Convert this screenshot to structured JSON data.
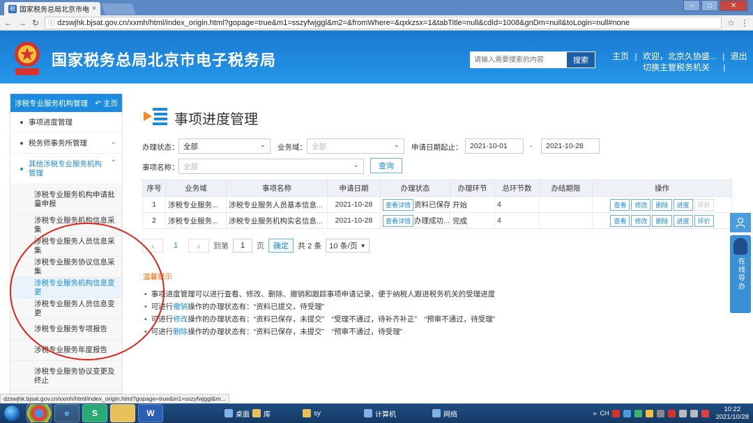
{
  "browser": {
    "tab_title": "国家税务总局北京市电子",
    "tab_close": "×",
    "url": "dzswjhk.bjsat.gov.cn/xxmh/html/index_origin.html?gopage=true&m1=sszyfwjggl&m2=&fromWhere=&qxkzsx=1&tabTitle=null&cdId=1008&gnDm=null&toLogin=null#none",
    "status_url": "dzswjhk.bjsat.gov.cn/xxmh/html/index_origin.html?gopage=true&m1=sszyfwjggl&m..."
  },
  "header": {
    "site_title": "国家税务总局北京市电子税务局",
    "search_placeholder": "请输入需要搜索的内容",
    "search_button": "搜索",
    "home_link": "主页",
    "welcome": "欢迎，北京久协盛...",
    "logout": "退出",
    "switch_authority": "切换主管税务机关",
    "sep": "|"
  },
  "sidebar": {
    "head_label": "涉税专业服务机构管理",
    "home_button": "主页",
    "items": [
      {
        "label": "事项进度管理"
      },
      {
        "label": "税务师事务所管理"
      },
      {
        "label": "其他涉税专业服务机构管理"
      }
    ],
    "subitems": [
      {
        "label": "涉税专业服务机构申请批量申报"
      },
      {
        "label": "涉税专业服务机构信息采集"
      },
      {
        "label": "涉税专业服务人员信息采集"
      },
      {
        "label": "涉税专业服务协议信息采集"
      },
      {
        "label": "涉税专业服务机构信息变更"
      },
      {
        "label": "涉税专业服务人员信息变更"
      },
      {
        "label": "涉税专业服务专项报告"
      },
      {
        "label": "涉税专业服务年度报告"
      },
      {
        "label": "涉税专业服务协议变更及终止"
      }
    ]
  },
  "main": {
    "title": "事项进度管理",
    "filters": {
      "status_label": "办理状态：",
      "status_value": "全部",
      "domain_label": "业务域：",
      "domain_placeholder": "全部",
      "date_label": "申请日期起止：",
      "date_from": "2021-10-01",
      "date_sep": "-",
      "date_to": "2021-10-28",
      "name_label": "事项名称：",
      "name_placeholder": "全部",
      "query_button": "查询"
    },
    "table": {
      "headers": [
        "序号",
        "业务域",
        "事项名称",
        "申请日期",
        "办理状态",
        "办理环节",
        "总环节数",
        "办结期限",
        "操作"
      ],
      "rows": [
        {
          "no": "1",
          "domain": "涉税专业服务...",
          "name": "涉税专业服务人员基本信息...",
          "date": "2021-10-28",
          "detail": "查看详情",
          "status": "资料已保存",
          "stage": "开始",
          "total": "4",
          "deadline": "",
          "ops": [
            "查看",
            "修改",
            "删除",
            "进度",
            "评价"
          ]
        },
        {
          "no": "2",
          "domain": "涉税专业服务...",
          "name": "涉税专业服务机构实名信息...",
          "date": "2021-10-28",
          "detail": "查看详情",
          "status": "办理成功...",
          "stage": "完成",
          "total": "4",
          "deadline": "",
          "ops": [
            "查看",
            "修改",
            "删除",
            "进度",
            "评价"
          ]
        }
      ]
    },
    "pager": {
      "current": "1",
      "goto_prefix": "到第",
      "goto_value": "1",
      "goto_suffix": "页",
      "confirm": "确定",
      "total": "共 2 条",
      "page_size": "10 条/页"
    },
    "tips": {
      "title": "温馨提示",
      "line1": "事项进度管理可以进行查看、修改、删除、撤销和跟踪事项申请记录，便于纳税人跟进税务机关的受理进度",
      "line2_pre": "可进行",
      "line2_hl": "撤销",
      "line2_post": "操作的办理状态有：“资料已提交，待受理”",
      "line3_pre": "可进行",
      "line3_hl": "修改",
      "line3_post": "操作的办理状态有：“资料已保存，未提交”　“受理不通过，待补齐补正”　“预审不通过，待受理”",
      "line4_pre": "可进行",
      "line4_hl": "删除",
      "line4_post": "操作的办理状态有：“资料已保存，未提交”　“预审不通过，待受理”"
    }
  },
  "float_widget": {
    "label": "在线导办"
  },
  "taskbar": {
    "items": [
      "桌面",
      "库",
      "sy",
      "计算机",
      "网络"
    ],
    "lang": "CH",
    "time": "10:22",
    "date": "2021/10/28"
  }
}
